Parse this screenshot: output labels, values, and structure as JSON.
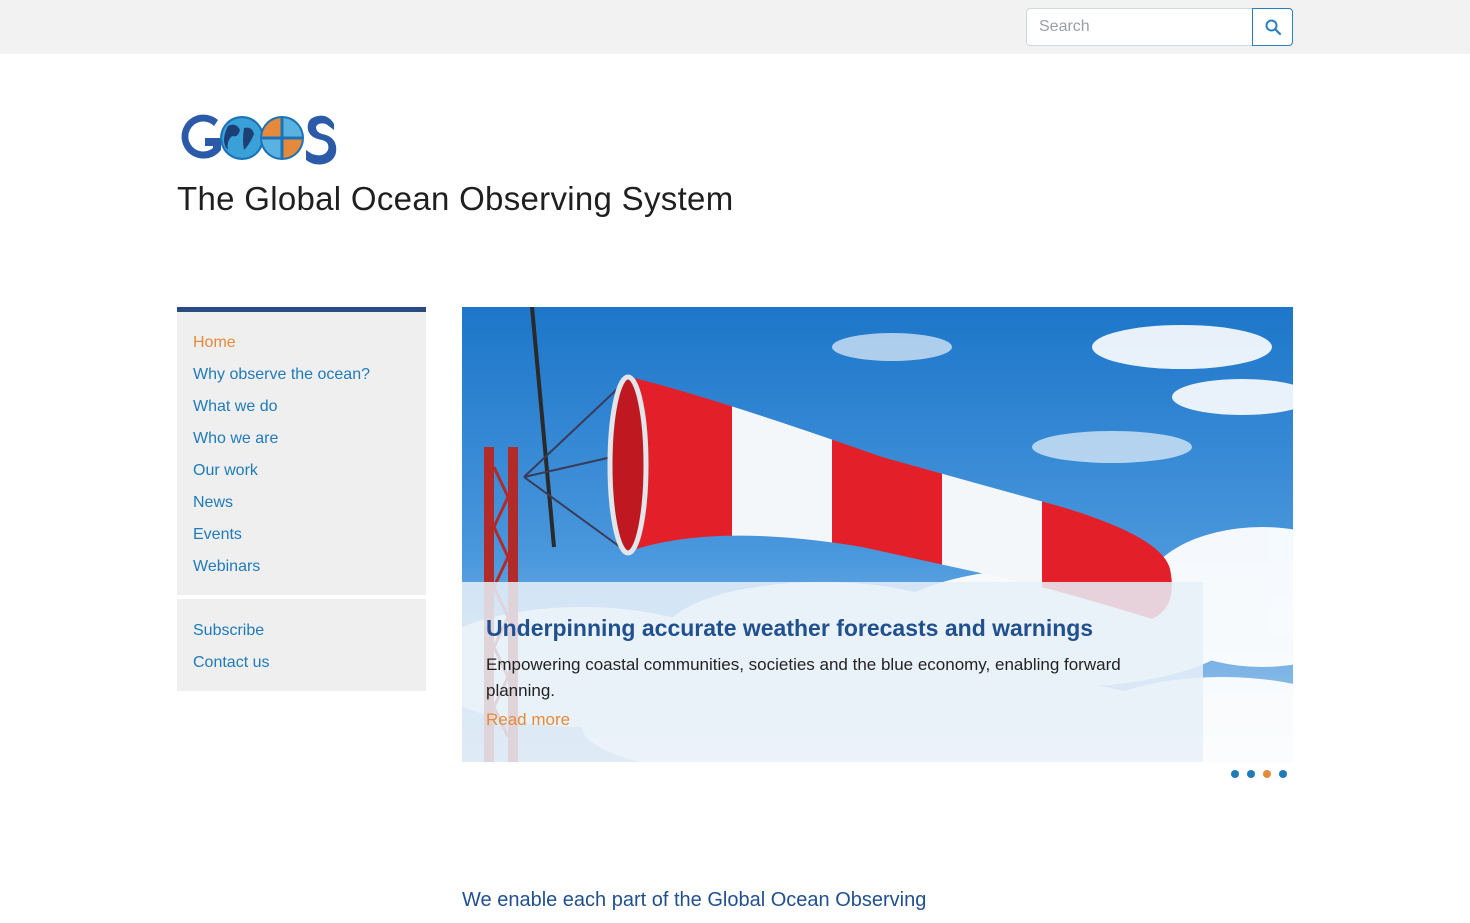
{
  "search": {
    "placeholder": "Search",
    "button_icon": "search-icon"
  },
  "site": {
    "logo_text": "GOOS",
    "title": "The Global Ocean Observing System"
  },
  "nav": {
    "primary": [
      {
        "label": "Home",
        "active": true
      },
      {
        "label": "Why observe the ocean?",
        "active": false
      },
      {
        "label": "What we do",
        "active": false
      },
      {
        "label": "Who we are",
        "active": false
      },
      {
        "label": "Our work",
        "active": false
      },
      {
        "label": "News",
        "active": false
      },
      {
        "label": "Events",
        "active": false
      },
      {
        "label": "Webinars",
        "active": false
      }
    ],
    "secondary": [
      {
        "label": "Subscribe"
      },
      {
        "label": "Contact us"
      }
    ]
  },
  "slider": {
    "heading": "Underpinning accurate weather forecasts and warnings",
    "text": "Empowering coastal communities, societies and the blue economy, enabling forward planning.",
    "link": "Read more",
    "slide_count": 4,
    "active_slide": 3
  },
  "intro": {
    "text": "We enable each part of the Global Ocean Observing"
  },
  "colors": {
    "link": "#1f7bb8",
    "active": "#e58a3a",
    "heading": "#21508f",
    "nav_border": "#2a4a84"
  }
}
